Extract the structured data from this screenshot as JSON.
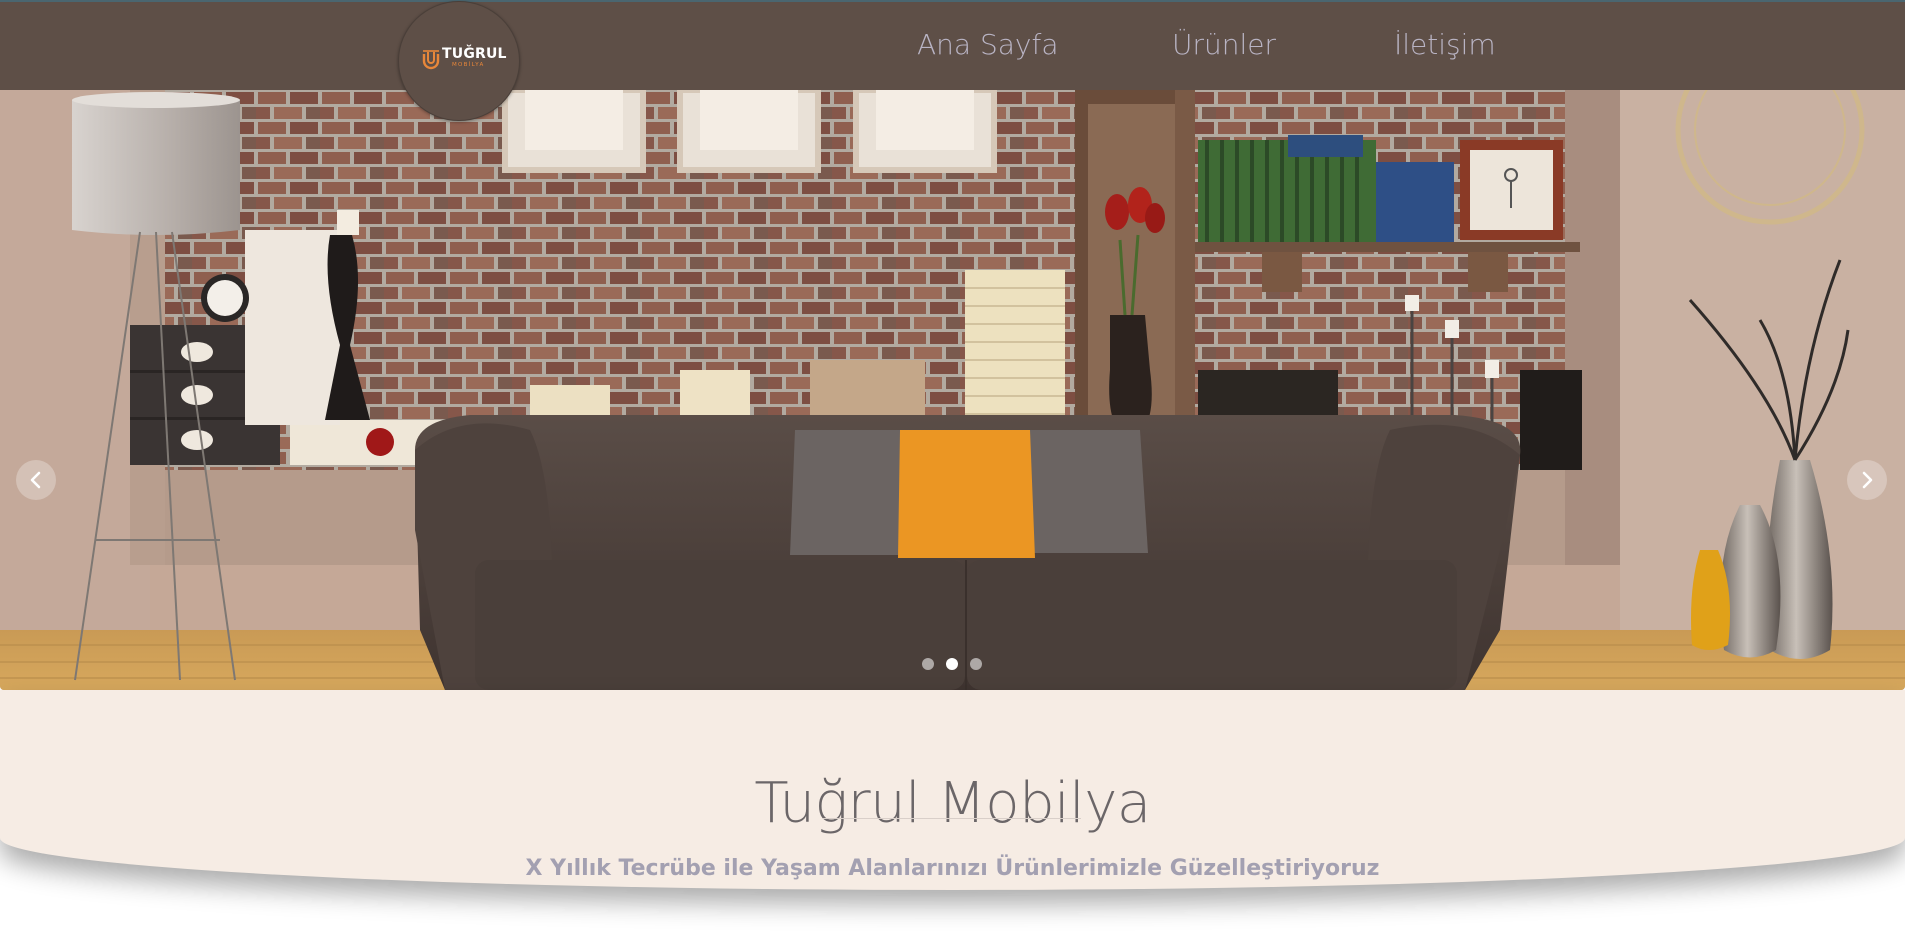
{
  "brand": {
    "logo_name": "TUĞRUL",
    "logo_subtitle": "MOBİLYA",
    "accent_color": "#e8873a",
    "nav_color": "#5e4f47"
  },
  "nav": {
    "items": [
      {
        "label": "Ana Sayfa"
      },
      {
        "label": "Ürünler"
      },
      {
        "label": "İletişim"
      }
    ]
  },
  "carousel": {
    "slide_count": 3,
    "active_index": 2,
    "prev_icon": "chevron-left-icon",
    "next_icon": "chevron-right-icon"
  },
  "banner": {
    "title": "Tuğrul Mobilya",
    "tagline": "X Yıllık Tecrübe ile Yaşam Alanlarınızı Ürünlerimizle Güzelleştiriyoruz",
    "background": "#f6ece4"
  }
}
